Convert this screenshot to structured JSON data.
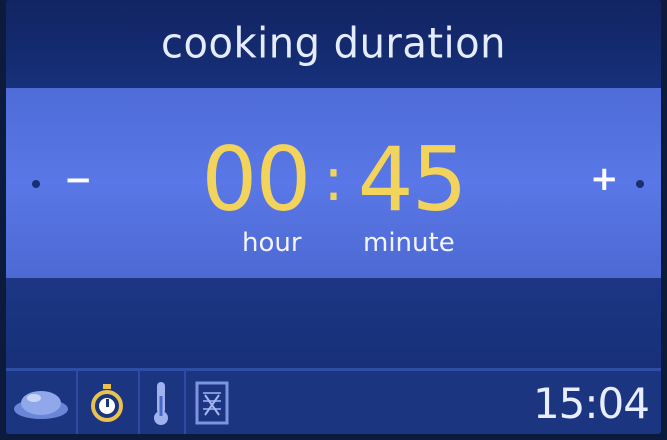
{
  "header": {
    "title": "cooking duration"
  },
  "timer": {
    "hours": "00",
    "separator": ":",
    "minutes": "45",
    "hour_label": "hour",
    "minute_label": "minute",
    "decrease_label": "−",
    "increase_label": "+"
  },
  "status": {
    "time": "15:04",
    "icons": [
      "dish-icon",
      "timer-icon",
      "thermometer-icon",
      "grill-mode-icon"
    ]
  },
  "colors": {
    "digits": "#f2d35c",
    "band": "#5977e6",
    "background": "#14286a"
  }
}
